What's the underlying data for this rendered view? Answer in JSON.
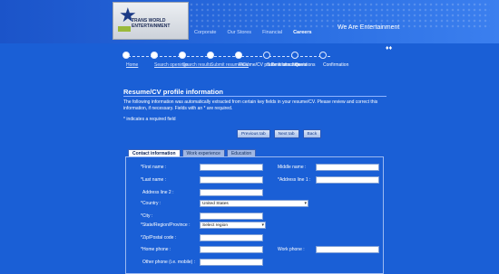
{
  "header": {
    "logo_lines": [
      "TRANS WORLD",
      "ENTERTAINMENT"
    ],
    "tagline": "We Are Entertainment",
    "side_mark": "♦♦"
  },
  "nav": [
    "Corporate",
    "Our Stores",
    "Financial",
    "Careers"
  ],
  "steps": [
    {
      "label": "Home",
      "state": "done"
    },
    {
      "label": "Search openings",
      "state": "done"
    },
    {
      "label": "Search results",
      "state": "done"
    },
    {
      "label": "Submit resume/CV",
      "state": "done"
    },
    {
      "label": "Resume/CV profile information",
      "state": "current"
    },
    {
      "label": "Submit attachments",
      "state": "todo"
    },
    {
      "label": "Questions",
      "state": "todo"
    },
    {
      "label": "Confirmation",
      "state": "todo"
    }
  ],
  "page": {
    "title": "Resume/CV profile information",
    "intro": "The following information was automatically extracted from certain key fields in your resume/CV. Please review and correct this information, if necessary. Fields with an * are required.",
    "required_note": "* indicates a required field"
  },
  "buttons": {
    "previous": "Previous tab",
    "next": "Next tab",
    "back": "Back"
  },
  "tabs": [
    "Contact information",
    "Work experience",
    "Education"
  ],
  "form": {
    "first_name": "*First name :",
    "middle_name": "Middle name :",
    "last_name": "*Last name :",
    "address1": "*Address line 1 :",
    "address2": "Address line 2 :",
    "country": "*Country :",
    "country_value": "United States",
    "city": "*City :",
    "state": "*State/Region/Province :",
    "state_value": "Select region",
    "zip": "*Zip/Postal code :",
    "home_phone": "*Home phone :",
    "work_phone": "Work phone :",
    "other_phone": "Other phone (i.e. mobile) :"
  }
}
